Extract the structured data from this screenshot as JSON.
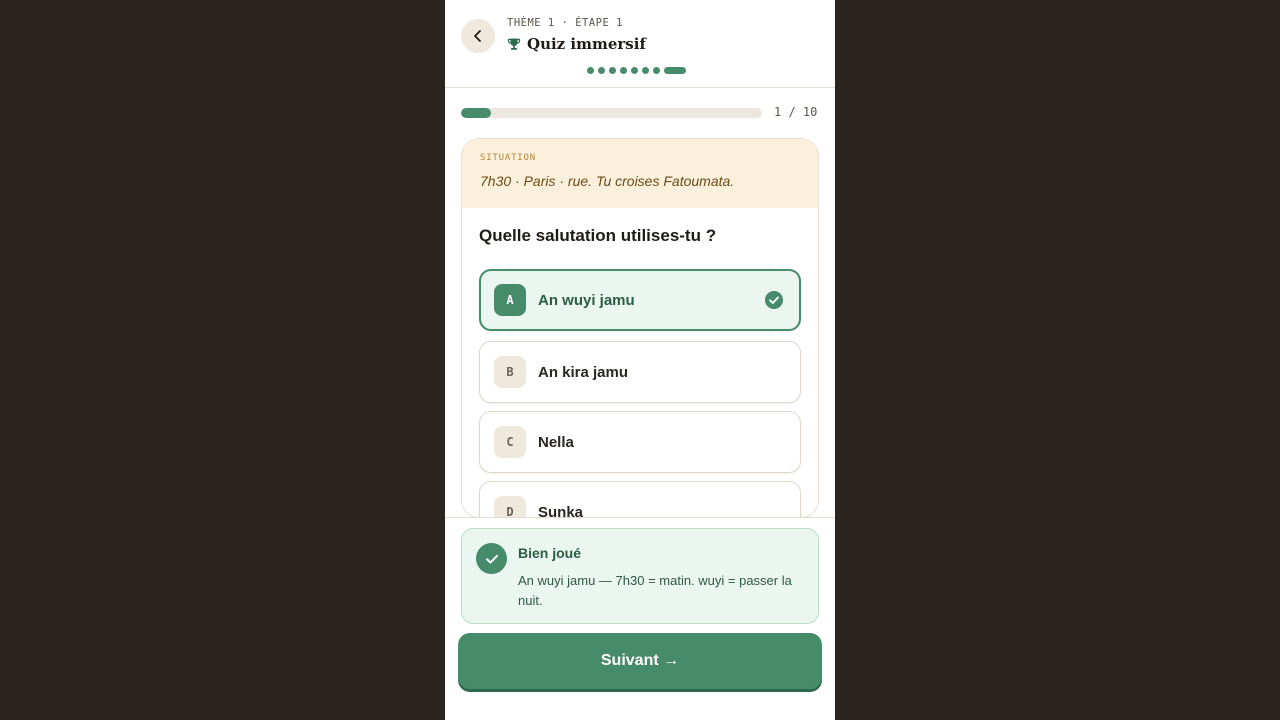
{
  "header": {
    "eyebrow": "THÈME 1 · ÉTAPE 1",
    "title": "Quiz immersif",
    "steps_total": 8,
    "steps_active_index": 7
  },
  "progress": {
    "label": "1 / 10",
    "fraction": 0.1
  },
  "situation": {
    "label": "SITUATION",
    "text": "7h30 · Paris · rue. Tu croises Fatoumata."
  },
  "question": "Quelle salutation utilises-tu ?",
  "options": [
    {
      "letter": "A",
      "label": "An wuyi jamu",
      "state": "correct"
    },
    {
      "letter": "B",
      "label": "An kira jamu",
      "state": "default"
    },
    {
      "letter": "C",
      "label": "Nella",
      "state": "default"
    },
    {
      "letter": "D",
      "label": "Sunka",
      "state": "default"
    }
  ],
  "feedback": {
    "title": "Bien joué",
    "body": "An wuyi jamu — 7h30 = matin. wuyi = passer la nuit."
  },
  "next_button": "Suivant →",
  "colors": {
    "accent": "#468b6a",
    "situation_bg": "#fbf0dc",
    "feedback_bg": "#ebf6f0",
    "backdrop": "#2a2520"
  },
  "icons": {
    "back": "chevron-left-icon",
    "title": "trophy-icon",
    "selected": "check-circle-icon",
    "feedback": "check-icon"
  }
}
